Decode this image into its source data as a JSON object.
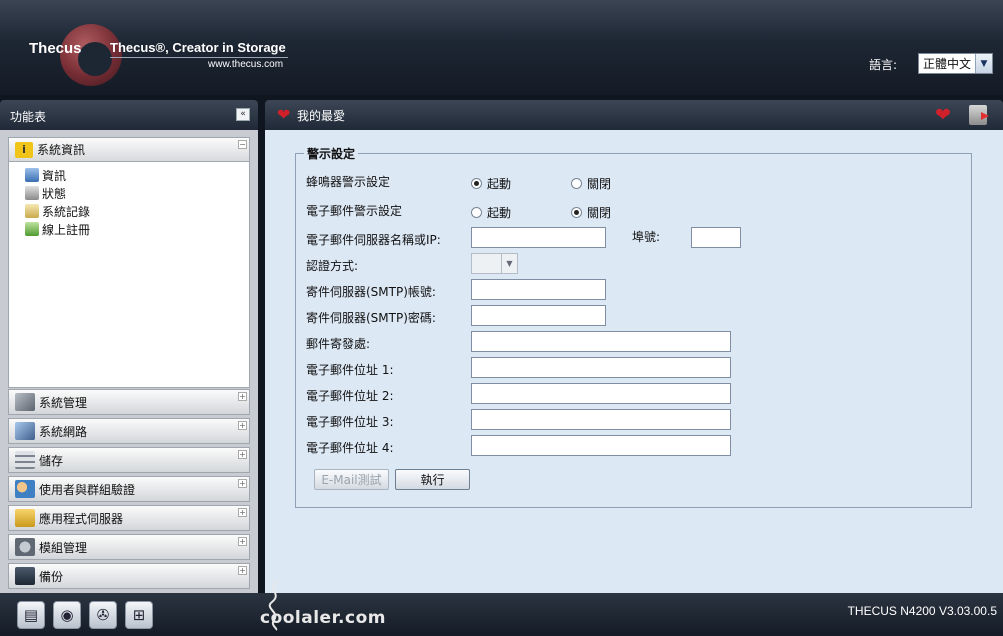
{
  "header": {
    "brand": "Thecus",
    "tagline": "Thecus®, Creator in Storage",
    "site": "www.thecus.com",
    "language_label": "語言:",
    "language_value": "正體中文"
  },
  "sidebar": {
    "title": "功能表",
    "open_group": {
      "label": "系統資訊",
      "items": [
        {
          "label": "資訊",
          "icon": "info-monitor-icon"
        },
        {
          "label": "狀態",
          "icon": "status-icon"
        },
        {
          "label": "系統記錄",
          "icon": "log-icon"
        },
        {
          "label": "線上註冊",
          "icon": "register-icon"
        }
      ]
    },
    "groups": [
      {
        "label": "系統管理",
        "icon": "tools-icon"
      },
      {
        "label": "系統網路",
        "icon": "network-icon"
      },
      {
        "label": "儲存",
        "icon": "storage-icon"
      },
      {
        "label": "使用者與群組驗證",
        "icon": "users-icon"
      },
      {
        "label": "應用程式伺服器",
        "icon": "app-server-icon"
      },
      {
        "label": "模組管理",
        "icon": "module-icon"
      },
      {
        "label": "備份",
        "icon": "backup-icon"
      }
    ]
  },
  "main": {
    "title": "我的最愛",
    "fieldset_title": "警示設定",
    "buzzer_label": "蜂鳴器警示設定",
    "email_alert_label": "電子郵件警示設定",
    "enable_label": "起動",
    "disable_label": "關閉",
    "server_label": "電子郵件伺服器名稱或IP:",
    "port_label": "埠號:",
    "auth_label": "認證方式:",
    "smtp_account_label": "寄件伺服器(SMTP)帳號:",
    "smtp_password_label": "寄件伺服器(SMTP)密碼:",
    "sender_label": "郵件寄發處:",
    "address1_label": "電子郵件位址 1:",
    "address2_label": "電子郵件位址 2:",
    "address3_label": "電子郵件位址 3:",
    "address4_label": "電子郵件位址 4:",
    "buzzer_enabled": true,
    "email_enabled": false,
    "test_button": "E-Mail測試",
    "apply_button": "執行"
  },
  "footer": {
    "watermark": "coolaler.com",
    "version": "THECUS N4200 V3.03.00.5",
    "icons": [
      "server-icon",
      "disk-icon",
      "fan-icon",
      "network-tree-icon"
    ]
  }
}
